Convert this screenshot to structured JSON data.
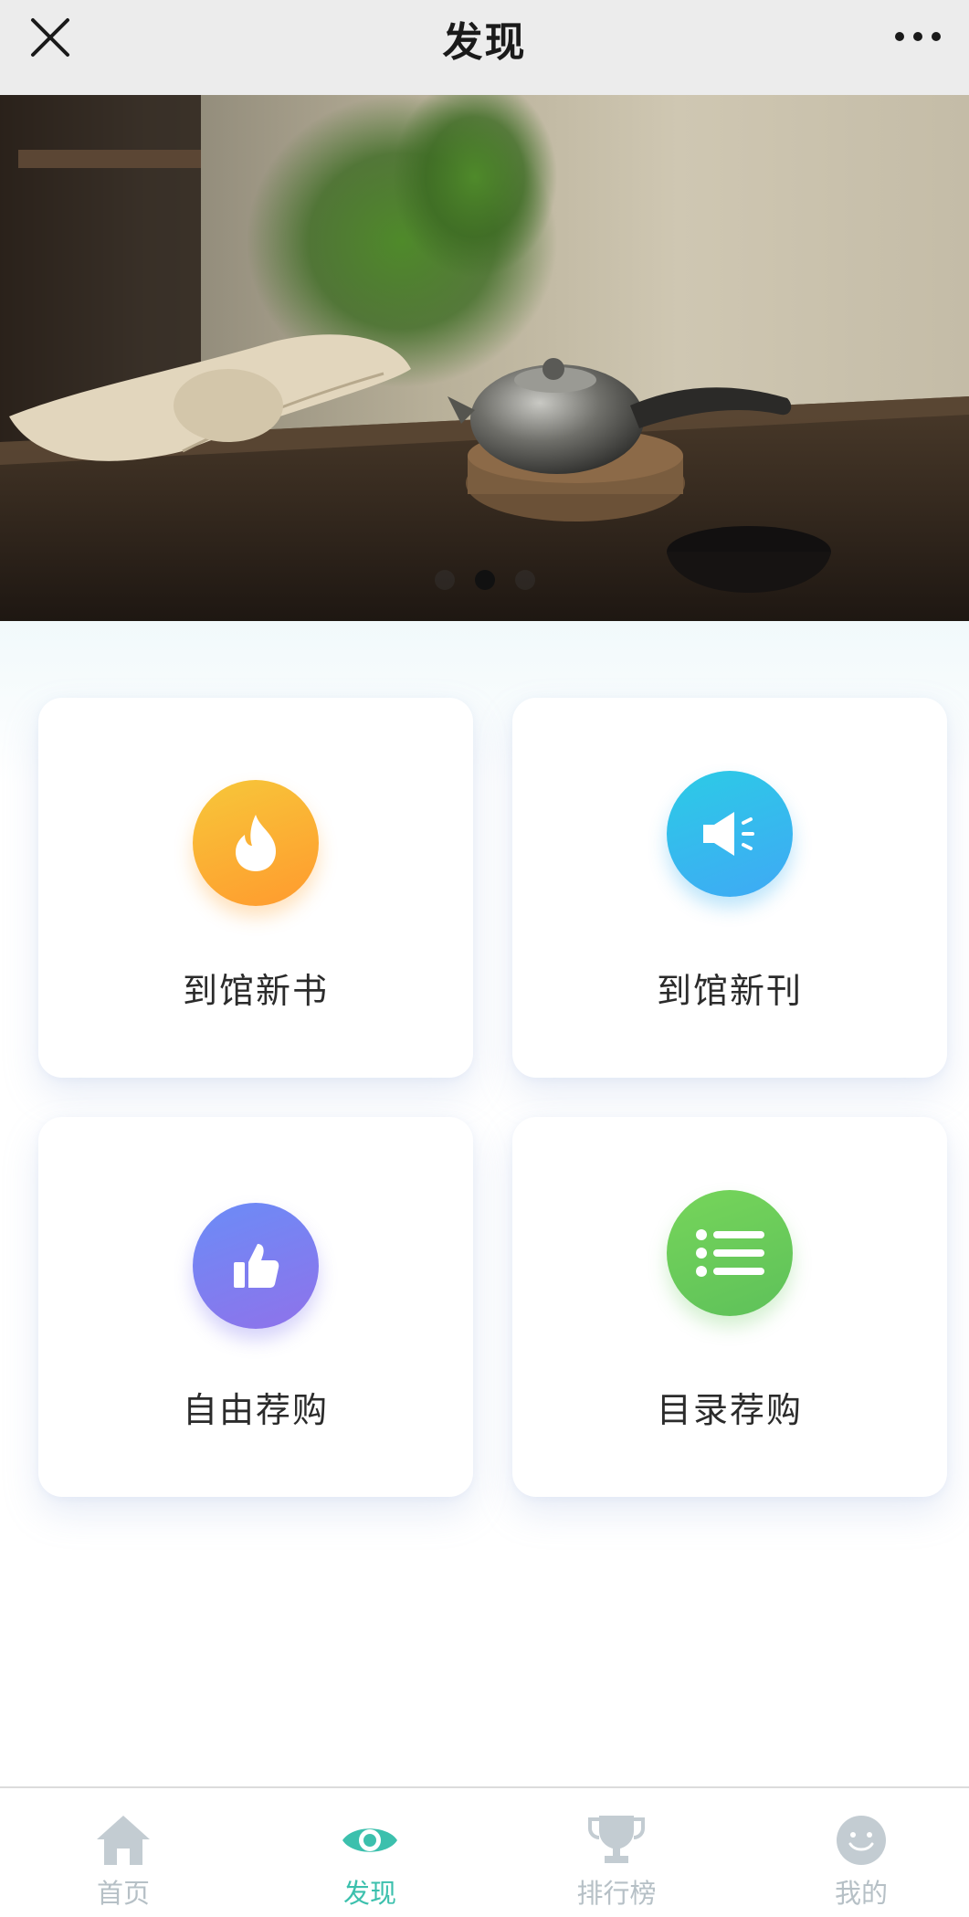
{
  "header": {
    "title": "发现",
    "close_icon": "close-icon",
    "more_icon": "more-dots-icon"
  },
  "banner": {
    "image": "teapot-and-book-photo",
    "slide_count": 3,
    "active_slide": 2
  },
  "cards": [
    {
      "label": "到馆新书",
      "icon": "flame-icon",
      "color": "#ffa82f"
    },
    {
      "label": "到馆新刊",
      "icon": "megaphone-icon",
      "color": "#34bdec"
    },
    {
      "label": "自由荐购",
      "icon": "thumbs-up-icon",
      "color": "#7b83f0"
    },
    {
      "label": "目录荐购",
      "icon": "list-icon",
      "color": "#6ccc5a"
    }
  ],
  "tabbar": {
    "tabs": [
      {
        "label": "首页",
        "icon": "home-icon",
        "active": false
      },
      {
        "label": "发现",
        "icon": "eye-icon",
        "active": true
      },
      {
        "label": "排行榜",
        "icon": "trophy-icon",
        "active": false
      },
      {
        "label": "我的",
        "icon": "smile-face-icon",
        "active": false
      }
    ],
    "active_color": "#3cc0ad",
    "inactive_color": "#b6c0c6"
  }
}
